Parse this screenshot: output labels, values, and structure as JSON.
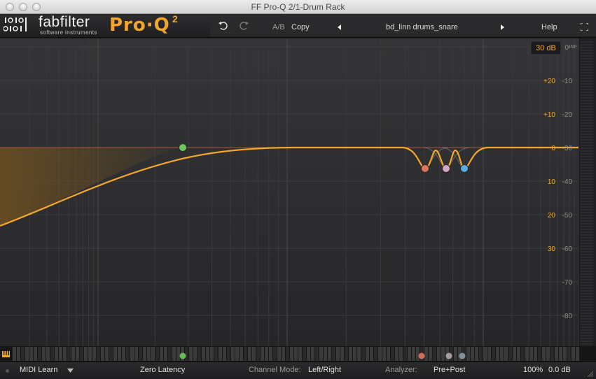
{
  "window": {
    "title": "FF Pro-Q 2/1-Drum Rack"
  },
  "header": {
    "brand": "fabfilter",
    "brand_sub": "software instruments",
    "product": "Pro·Q",
    "product_sup": "2",
    "ab_label": "A/B",
    "copy_label": "Copy",
    "preset_name": "bd_linn drums_snare",
    "help_label": "Help",
    "icons": [
      "undo-icon",
      "redo-icon",
      "prev-preset-icon",
      "next-preset-icon",
      "fullscreen-icon"
    ]
  },
  "graph": {
    "range_button": "30 dB",
    "eq_scale": [
      "+20",
      "+10",
      "0",
      "10",
      "20",
      "30"
    ],
    "meter_scale": [
      "-INF",
      "0",
      "-10",
      "-20",
      "-30",
      "-40",
      "-50",
      "-60",
      "-70",
      "-80"
    ],
    "colors": {
      "curve": "#f3a72a",
      "band_lowcut": "#6dc95b",
      "band_notch1": "#e0745f",
      "band_notch2": "#d4a9c8",
      "band_notch3": "#5aaee6"
    }
  },
  "statusbar": {
    "midi_learn": "MIDI Learn",
    "latency": "Zero Latency",
    "channel_mode_label": "Channel Mode:",
    "channel_mode_value": "Left/Right",
    "analyzer_label": "Analyzer:",
    "analyzer_value": "Pre+Post",
    "zoom": "100%",
    "gain": "0.0 dB"
  }
}
